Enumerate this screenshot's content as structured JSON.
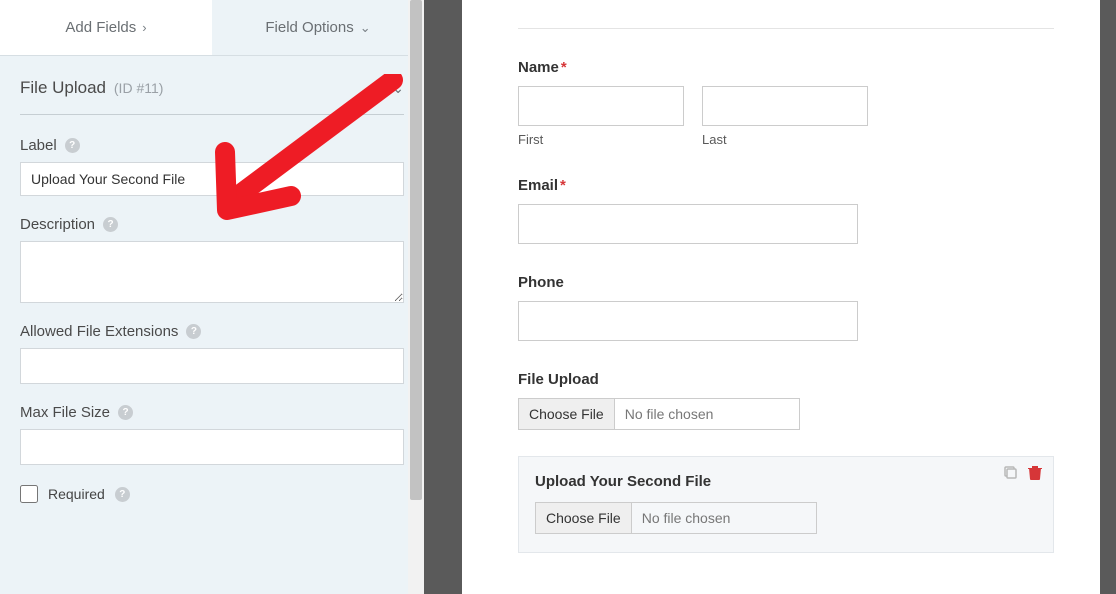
{
  "sidebar": {
    "tabs": {
      "add_fields": "Add Fields",
      "field_options": "Field Options"
    },
    "field_title": "File Upload",
    "field_id": "(ID #11)",
    "label_label": "Label",
    "label_value": "Upload Your Second File",
    "description_label": "Description",
    "description_value": "",
    "allowed_ext_label": "Allowed File Extensions",
    "max_size_label": "Max File Size",
    "required_label": "Required"
  },
  "preview": {
    "name_label": "Name",
    "first_sub": "First",
    "last_sub": "Last",
    "email_label": "Email",
    "phone_label": "Phone",
    "file1_label": "File Upload",
    "file2_label": "Upload Your Second File",
    "choose_btn": "Choose File",
    "no_file": "No file chosen"
  }
}
